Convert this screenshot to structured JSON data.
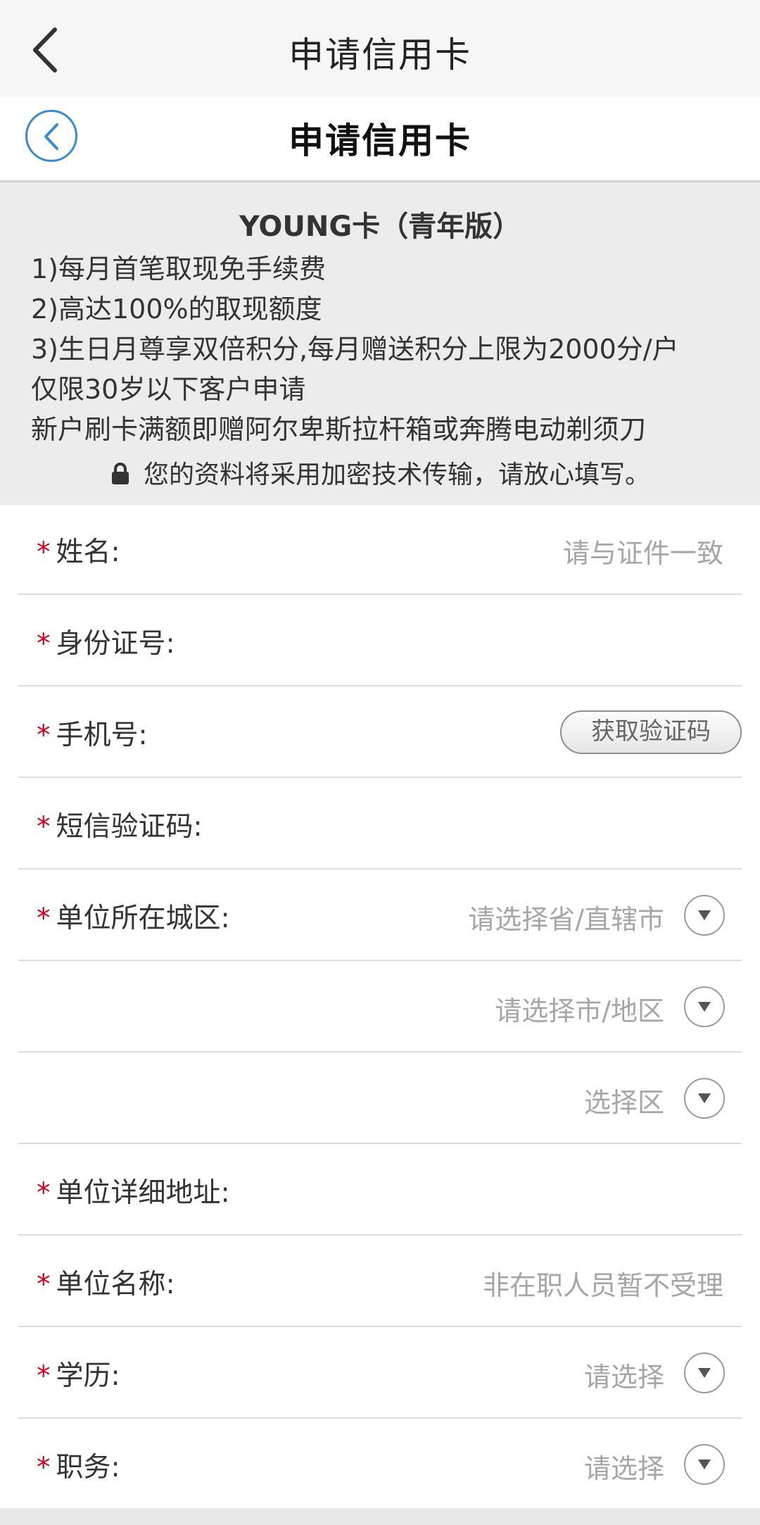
{
  "topbar": {
    "title": "申请信用卡",
    "back_icon": "chevron-left-icon"
  },
  "header": {
    "title": "申请信用卡",
    "back_icon": "circle-chevron-left-icon",
    "accent_color": "#3b8bd0",
    "required_color": "#d0021b"
  },
  "info": {
    "card_title": "YOUNG卡（青年版）",
    "lines": [
      "1)每月首笔取现免手续费",
      "2)高达100%的取现额度",
      "3)生日月尊享双倍积分,每月赠送积分上限为2000分/户",
      "仅限30岁以下客户申请",
      "新户刷卡满额即赠阿尔卑斯拉杆箱或奔腾电动剃须刀"
    ],
    "secure_note": "您的资料将采用加密技术传输，请放心填写。",
    "lock_icon": "lock-icon"
  },
  "form": {
    "required_mark": "*",
    "name": {
      "label": "姓名:",
      "placeholder": "请与证件一致"
    },
    "id_number": {
      "label": "身份证号:"
    },
    "phone": {
      "label": "手机号:",
      "button": "获取验证码"
    },
    "sms_code": {
      "label": "短信验证码:"
    },
    "work_city": {
      "label": "单位所在城区:",
      "province_placeholder": "请选择省/直辖市",
      "city_placeholder": "请选择市/地区",
      "district_placeholder": "选择区"
    },
    "work_address": {
      "label": "单位详细地址:"
    },
    "company_name": {
      "label": "单位名称:",
      "placeholder": "非在职人员暂不受理"
    },
    "education": {
      "label": "学历:",
      "placeholder": "请选择"
    },
    "position": {
      "label": "职务:",
      "placeholder": "请选择"
    },
    "dropdown_icon": "triangle-down-icon"
  }
}
